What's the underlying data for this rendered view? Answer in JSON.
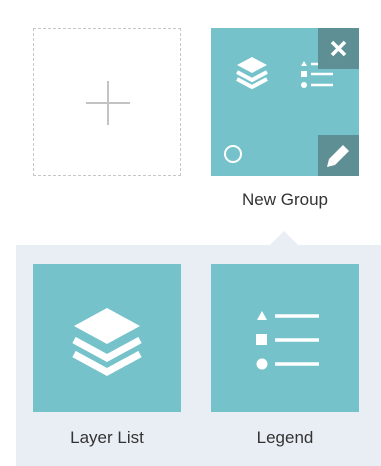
{
  "colors": {
    "tile": "#75c2ca",
    "tile_button": "#5d8f94",
    "panel": "#e9eef4",
    "icon": "#ffffff",
    "text": "#333333",
    "dashed_border": "#c7c7c7"
  },
  "add_tile": {
    "icon": "plus-icon"
  },
  "group": {
    "label": "New Group",
    "icons": [
      "layers-icon",
      "legend-icon",
      "radio-circle-icon",
      "close-icon",
      "pencil-icon"
    ]
  },
  "widgets": [
    {
      "label": "Layer List",
      "icon": "layers-icon"
    },
    {
      "label": "Legend",
      "icon": "legend-icon"
    }
  ]
}
